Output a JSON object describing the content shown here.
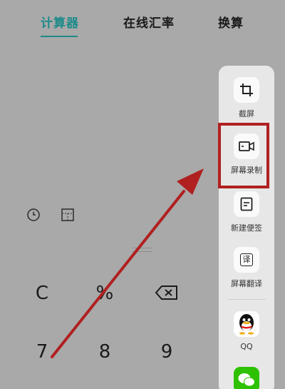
{
  "tabs": {
    "calculator": "计算器",
    "exchange_rate": "在线汇率",
    "conversion": "换算"
  },
  "tools": {
    "history_icon": "clock-icon",
    "mode_icon": "grid-icon"
  },
  "keypad": {
    "row1": [
      "C",
      "%",
      "⌫"
    ],
    "row2": [
      "7",
      "8",
      "9"
    ]
  },
  "side_panel": {
    "items": [
      {
        "label": "截屏",
        "icon": "crop-icon"
      },
      {
        "label": "屏幕录制",
        "icon": "video-icon"
      },
      {
        "label": "新建便签",
        "icon": "note-icon"
      },
      {
        "label": "屏幕翻译",
        "icon": "translate-icon"
      },
      {
        "label": "QQ",
        "icon": "qq-icon"
      },
      {
        "label": "",
        "icon": "wechat-icon"
      }
    ],
    "translate_glyph": "译"
  },
  "colors": {
    "active_tab": "#1f8a8a",
    "annotation_red": "#b02020",
    "background": "#a9a9a9",
    "panel": "#e7e7e7"
  }
}
